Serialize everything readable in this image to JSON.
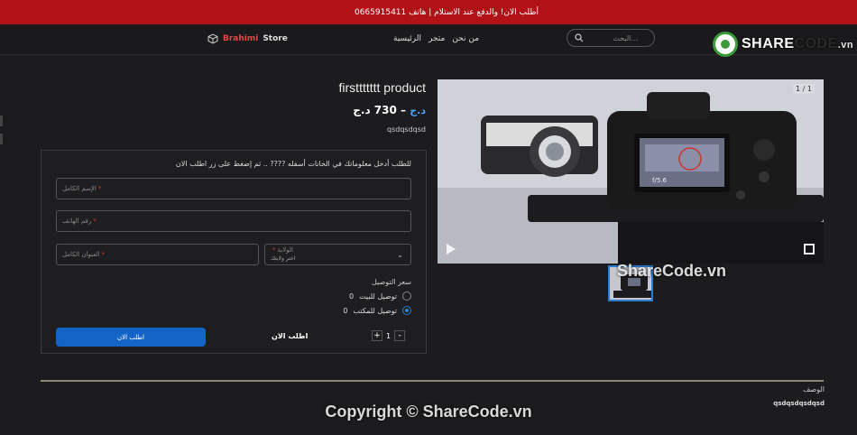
{
  "announcement": "أطلب الان! والدفع عند الاستلام | هاتف 0665915411",
  "header": {
    "brand_prefix": "Brahimi",
    "brand_suffix": "Store",
    "nav": [
      "من نحن",
      "متجر",
      "الرئيسية"
    ],
    "search_placeholder": "البحث..."
  },
  "watermark": {
    "logo_share": "SHARE",
    "logo_code": "CODE",
    "logo_vn": ".vn",
    "middle": "ShareCode.vn",
    "copyright": "Copyright © ShareCode.vn"
  },
  "gallery": {
    "counter": "1 / 1",
    "lens_text": "f/5.6"
  },
  "product": {
    "title": "firsttttttt product",
    "price": "730 د.ج",
    "old_price": "د.ج",
    "description": "qsdqsdqsd"
  },
  "form": {
    "note": "للطلب أدخل معلوماتك في الخانات أسفله ???? .. ثم إضغط على زر اطلب الان",
    "full_name_placeholder": "الإسم الكامل",
    "phone_placeholder": "رقم الهاتف",
    "address_placeholder": "العنوان الكامل",
    "state_label": "الولاية",
    "state_value": "اختر ولايتك",
    "shipping_title": "سعر التوصيل",
    "shipping_options": [
      {
        "label": "توصيل للبيت",
        "price": "0",
        "selected": false
      },
      {
        "label": "توصيل للمكتب",
        "price": "0",
        "selected": true
      }
    ],
    "order_button": "اطلب الان",
    "order_label": "اطلب الان",
    "quantity": "1",
    "plus": "+",
    "minus": "-"
  },
  "description_tab": {
    "label": "الوصف",
    "body": "qsdqsdqsdqsd"
  },
  "colors": {
    "announcement_bg": "#b01217",
    "accent": "#1464c8",
    "page_bg": "#1c1c1e"
  }
}
